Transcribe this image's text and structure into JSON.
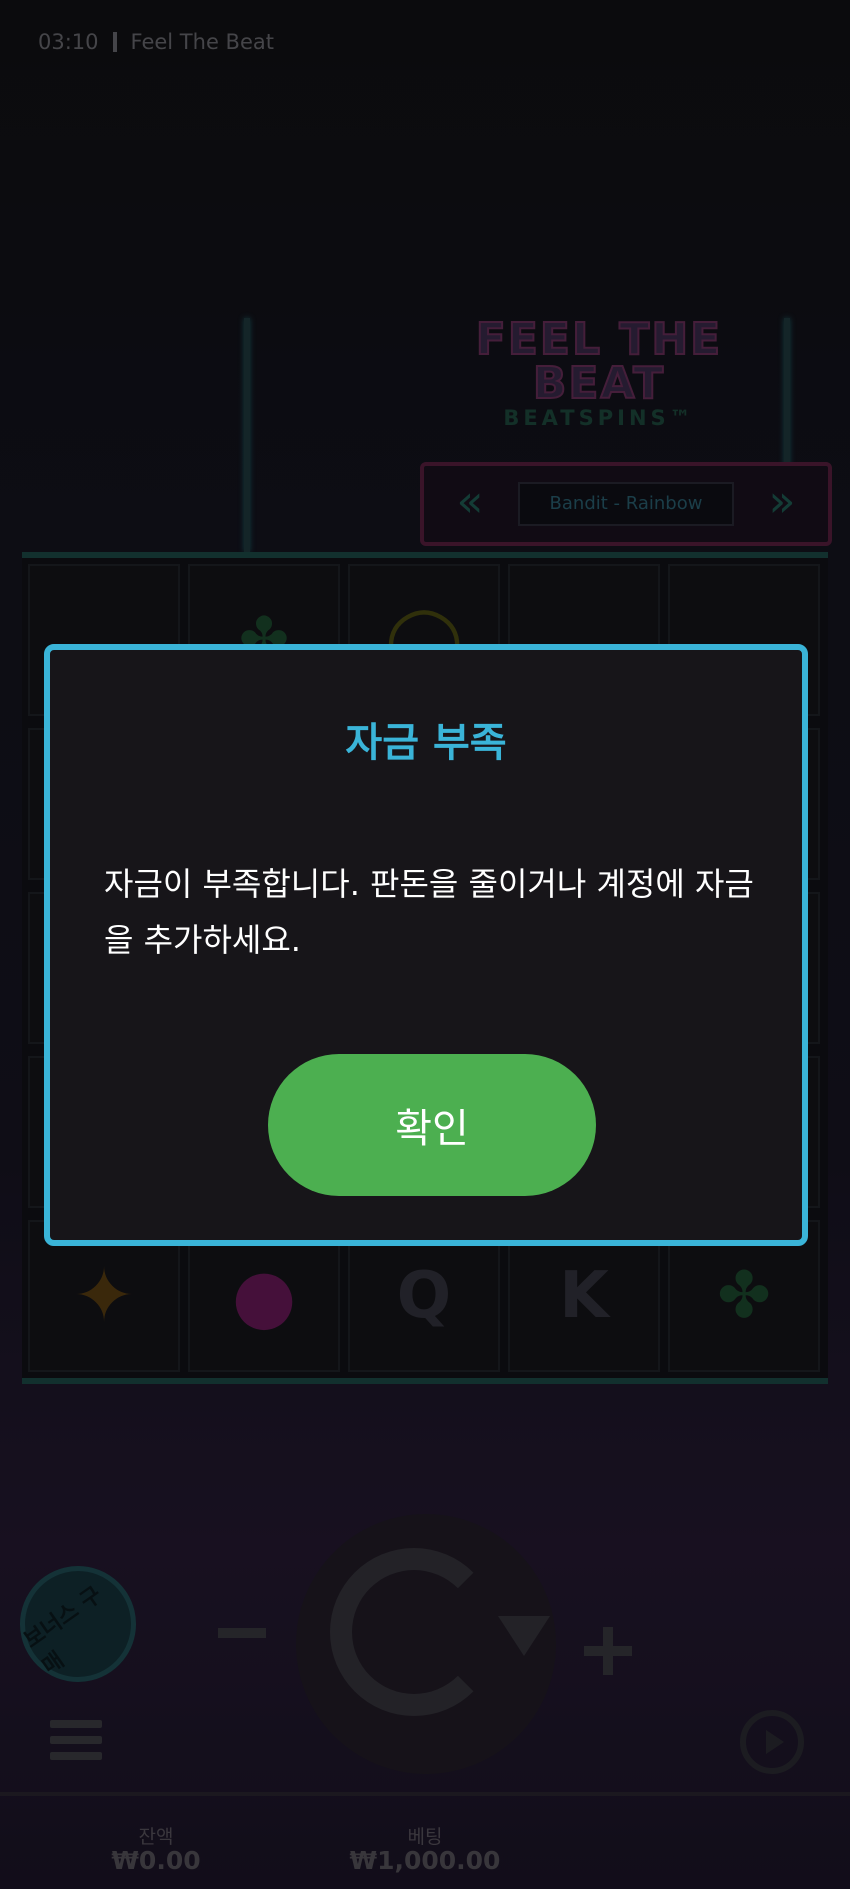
{
  "status_bar": {
    "time": "03:10",
    "game_title": "Feel The Beat"
  },
  "game": {
    "logo_line1": "FEEL THE",
    "logo_line2": "BEAT",
    "logo_line3": "BEATSPINS™",
    "track_name": "Bandit - Rainbow",
    "prev_icon": "rewind-icon",
    "next_icon": "fast-forward-icon"
  },
  "controls": {
    "bonus_label": "보너스 구매",
    "minus_label": "−",
    "plus_label": "+",
    "balance_label": "잔액",
    "balance_value": "₩0.00",
    "bet_label": "베팅",
    "bet_value": "₩1,000.00"
  },
  "dialog": {
    "title": "자금 부족",
    "message": "자금이 부족합니다. 판돈을 줄이거나 계정에 자금을 추가하세요.",
    "confirm_label": "확인"
  },
  "colors": {
    "accent": "#3ab4d8",
    "confirm_button": "#4caf50"
  }
}
